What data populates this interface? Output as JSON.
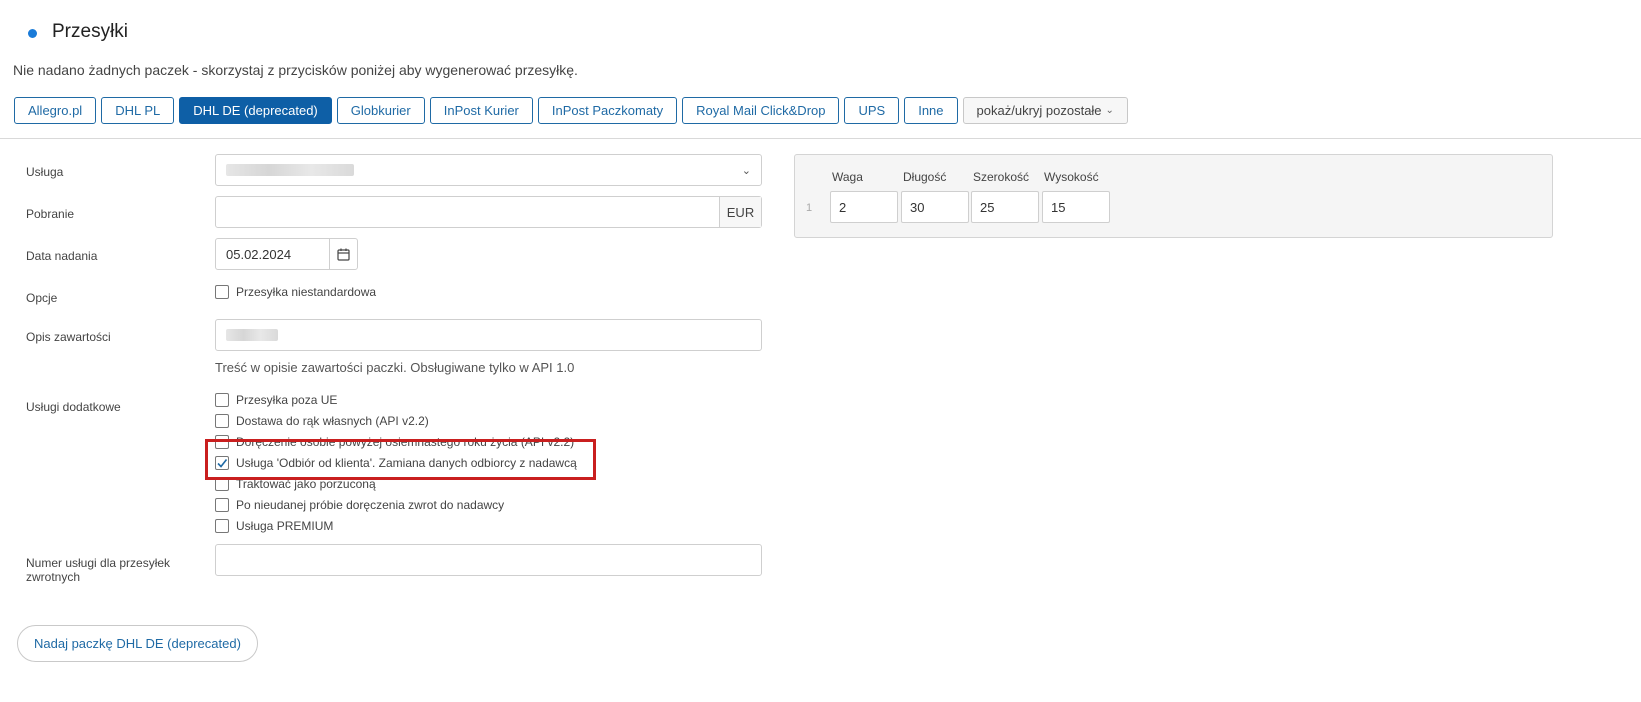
{
  "header": {
    "title": "Przesyłki",
    "subtitle": "Nie nadano żadnych paczek - skorzystaj z przycisków poniżej aby wygenerować przesyłkę.",
    "accent_color": "#1a7bd8"
  },
  "carriers": {
    "items": [
      {
        "label": "Allegro.pl"
      },
      {
        "label": "DHL PL"
      },
      {
        "label": "DHL DE (deprecated)",
        "active": true
      },
      {
        "label": "Globkurier"
      },
      {
        "label": "InPost Kurier"
      },
      {
        "label": "InPost Paczkomaty"
      },
      {
        "label": "Royal Mail Click&Drop"
      },
      {
        "label": "UPS"
      },
      {
        "label": "Inne"
      }
    ],
    "toggle_label": "pokaż/ukryj pozostałe",
    "active_color": "#0e5fa6"
  },
  "form": {
    "service_label": "Usługa",
    "cod_label": "Pobranie",
    "cod_currency": "EUR",
    "date_label": "Data nadania",
    "date_value": "05.02.2024",
    "options_label": "Opcje",
    "options_checkbox": "Przesyłka niestandardowa",
    "content_label": "Opis zawartości",
    "content_help": "Treść w opisie zawartości paczki. Obsługiwane tylko w API 1.0",
    "extra_label": "Usługi dodatkowe",
    "extra_services": [
      {
        "label": "Przesyłka poza UE",
        "checked": false
      },
      {
        "label": "Dostawa do rąk własnych (API v2.2)",
        "checked": false
      },
      {
        "label": "Doręczenie osobie powyżej osiemnastego roku życia (API v2.2)",
        "checked": false
      },
      {
        "label": "Usługa 'Odbiór od klienta'. Zamiana danych odbiorcy z nadawcą",
        "checked": true
      },
      {
        "label": "Traktować jako porzuconą",
        "checked": false
      },
      {
        "label": "Po nieudanej próbie doręczenia zwrot do nadawcy",
        "checked": false
      },
      {
        "label": "Usługa PREMIUM",
        "checked": false
      }
    ],
    "return_label_line1": "Numer usługi dla przesyłek",
    "return_label_line2": "zwrotnych",
    "submit_label": "Nadaj paczkę DHL DE (deprecated)",
    "highlight_color": "#c91f1f"
  },
  "dimensions": {
    "headers": [
      "Waga",
      "Długość",
      "Szerokość",
      "Wysokość"
    ],
    "rows": [
      {
        "index": "1",
        "values": [
          "2",
          "30",
          "25",
          "15"
        ]
      }
    ]
  }
}
